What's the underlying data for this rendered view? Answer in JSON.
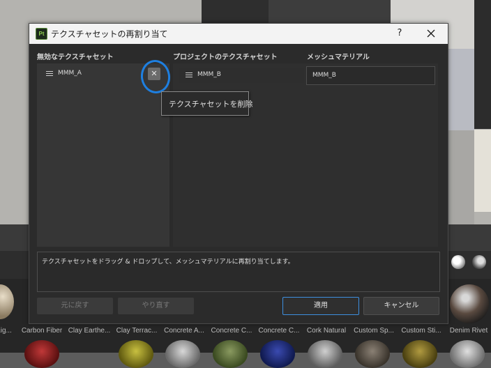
{
  "dialog": {
    "app_icon_label": "Pt",
    "title": "テクスチャセットの再割り当て",
    "help_label": "?"
  },
  "columns": {
    "unused_header": "無効なテクスチャセット",
    "project_header": "プロジェクトのテクスチャセット",
    "mesh_header": "メッシュマテリアル"
  },
  "unused_items": [
    {
      "label": "MMM_A"
    }
  ],
  "project_items": [
    {
      "label": "MMM_B",
      "mesh_material": "MMM_B"
    }
  ],
  "tooltip": "テクスチャセットを削除",
  "info_text": "テクスチャセットをドラッグ & ドロップして、メッシュマテリアルに再割り当てします。",
  "buttons": {
    "undo": "元に戻す",
    "redo": "やり直す",
    "apply": "適用",
    "cancel": "キャンセル"
  },
  "shelf": {
    "labels": [
      "Lig...",
      "Carbon Fiber",
      "Clay Earthe...",
      "Clay Terrac...",
      "Concrete A...",
      "Concrete C...",
      "Concrete C...",
      "Cork Natural",
      "Custom Sp...",
      "Custom Sti...",
      "Denim Rivet"
    ]
  },
  "colors": {
    "annotation": "#1e7fe0",
    "primary_border": "#3d8fe0"
  }
}
